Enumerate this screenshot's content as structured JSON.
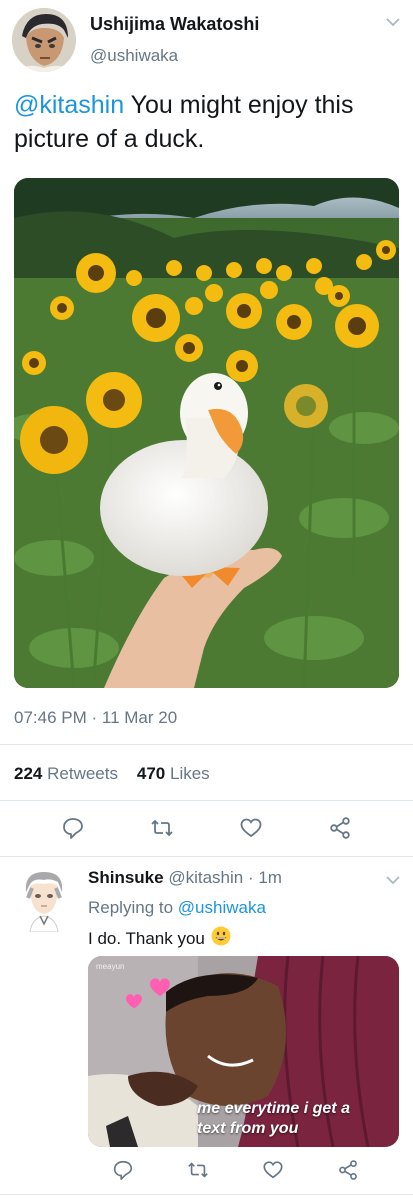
{
  "tweet": {
    "author_name": "Ushijima Wakatoshi",
    "author_handle": "@ushiwaka",
    "mention": "@kitashin",
    "text_after_mention": " You might enjoy this picture of a duck.",
    "time": "07:46 PM · 11 Mar 20",
    "retweets_count": "224",
    "retweets_label": "Retweets",
    "likes_count": "470",
    "likes_label": "Likes",
    "icons": [
      "chevron-down",
      "reply",
      "retweet",
      "like",
      "share"
    ]
  },
  "reply": {
    "author_name": "Shinsuke",
    "author_handle": "@kitashin",
    "time_ago": "· 1m",
    "replying_prefix": "Replying to",
    "replying_handle": "@ushiwaka",
    "text": "I do. Thank you",
    "emoji": "grinning-face",
    "meme_watermark": "meayun",
    "meme_caption": "me everytime i get a text from you",
    "icons": [
      "chevron-down",
      "reply",
      "retweet",
      "like",
      "share"
    ]
  },
  "colors": {
    "link": "#1b95e0",
    "secondary_text": "#657786",
    "primary_text": "#14171a",
    "divider": "#e1e8ed"
  }
}
